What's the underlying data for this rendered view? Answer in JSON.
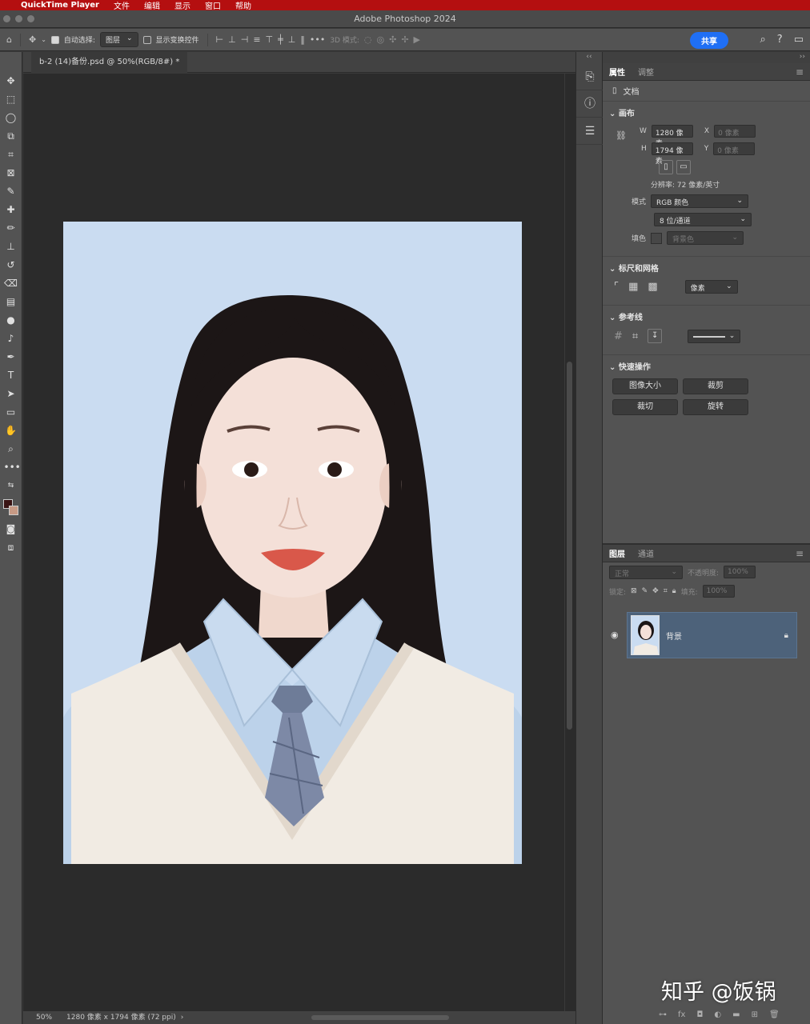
{
  "menubar": {
    "app_name": "QuickTime Player",
    "items": [
      "文件",
      "编辑",
      "显示",
      "窗口",
      "帮助"
    ]
  },
  "window": {
    "title": "Adobe Photoshop 2024"
  },
  "options_bar": {
    "auto_select_label": "自动选择:",
    "auto_select_value": "图层",
    "show_transform_label": "显示变换控件",
    "mode_3d_label": "3D 模式:",
    "share_label": "共享",
    "accent_color": "#1f6ff5"
  },
  "document": {
    "tab_label": "b-2 (14)备份.psd @ 50%(RGB/8#) *",
    "photo_background_color": "#cadcf1"
  },
  "status_bar": {
    "zoom": "50%",
    "size_info": "1280 像素 x 1794 像素 (72 ppi)",
    "arrow": "›"
  },
  "properties_panel": {
    "tabs": [
      "属性",
      "调整"
    ],
    "doc_label": "文档",
    "canvas": {
      "title": "画布",
      "w_label": "W",
      "w_value": "1280 像素",
      "h_label": "H",
      "h_value": "1794 像素",
      "x_label": "X",
      "x_value": "0 像素",
      "y_label": "Y",
      "y_value": "0 像素",
      "resolution": "分辨率: 72 像素/英寸",
      "mode_label": "模式",
      "mode_value": "RGB 颜色",
      "depth_value": "8 位/通道",
      "fill_label": "填色",
      "fill_value": "背景色"
    },
    "rulers": {
      "title": "标尺和网格",
      "unit": "像素"
    },
    "guides": {
      "title": "参考线"
    },
    "quick_actions": {
      "title": "快速操作",
      "buttons": [
        "图像大小",
        "裁剪",
        "裁切",
        "旋转"
      ]
    }
  },
  "layers_panel": {
    "tabs": [
      "图层",
      "通道"
    ],
    "blend_mode": "正常",
    "opacity_label": "不透明度:",
    "opacity_value": "100%",
    "lock_label": "锁定:",
    "fill_label": "填充:",
    "fill_value": "100%",
    "layer_name": "背景",
    "bottom_icons": [
      "link-icon",
      "fx-icon",
      "mask-icon",
      "adjustment-icon",
      "folder-icon",
      "new-layer-icon",
      "trash-icon"
    ],
    "selected_color": "#4d627a"
  },
  "watermark": "知乎 @饭锅"
}
